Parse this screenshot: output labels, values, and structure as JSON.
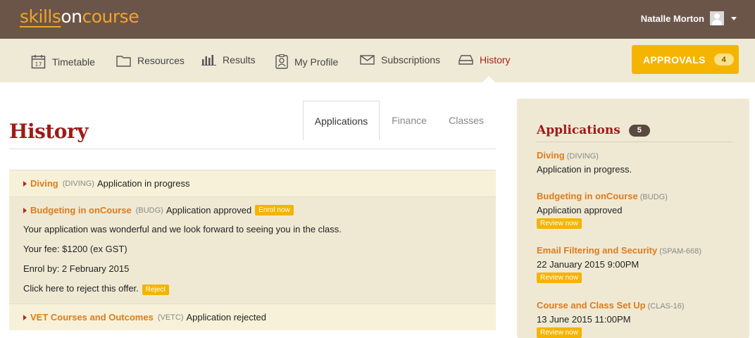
{
  "header": {
    "logo": {
      "part1": "skills",
      "part2": "on",
      "part3": "course"
    },
    "user_name": "Natalle Morton"
  },
  "nav": {
    "items": [
      {
        "label": "Timetable",
        "icon": "calendar-icon"
      },
      {
        "label": "Resources",
        "icon": "folder-icon"
      },
      {
        "label": "Results",
        "icon": "bar-chart-icon"
      },
      {
        "label": "My Profile",
        "icon": "profile-icon"
      },
      {
        "label": "Subscriptions",
        "icon": "envelope-icon"
      },
      {
        "label": "History",
        "icon": "inbox-icon",
        "active": true
      }
    ],
    "approvals_label": "APPROVALS",
    "approvals_count": "4"
  },
  "page": {
    "title": "History",
    "tabs": [
      "Applications",
      "Finance",
      "Classes"
    ]
  },
  "applications": [
    {
      "name": "Diving",
      "code": "(DIVING)",
      "status": "Application in progress"
    },
    {
      "name": "Budgeting in onCourse",
      "code": "(BUDG)",
      "status": "Application approved",
      "badge": "Enrol now",
      "message": "Your application was wonderful and we look forward to seeing you in the class.",
      "fee": "Your fee: $1200 (ex GST)",
      "enrol_by": "Enrol by: 2 February 2015",
      "reject_text": "Click here to reject this offer.",
      "reject_label": "Reject"
    },
    {
      "name": "VET Courses and Outcomes",
      "code": "(VETC)",
      "status": "Application rejected"
    }
  ],
  "sidebar": {
    "title": "Applications",
    "count": "5",
    "items": [
      {
        "name": "Diving",
        "code": "(DIVING)",
        "desc": "Application in progress."
      },
      {
        "name": "Budgeting in onCourse",
        "code": "(BUDG)",
        "desc": "Application approved",
        "button": "Review now"
      },
      {
        "name": "Email Filtering and Security",
        "code": "(SPAM-668)",
        "desc": "22 January 2015 9:00PM",
        "button": "Review now"
      },
      {
        "name": "Course and Class Set Up",
        "code": "(CLAS-16)",
        "desc": "13 June 2015 11:00PM",
        "button": "Review now"
      }
    ]
  },
  "colors": {
    "header_bg": "#6b5549",
    "nav_bg": "#efead6",
    "accent": "#f5b400",
    "title_red": "#9e1a16",
    "link_orange": "#e07b1a"
  }
}
